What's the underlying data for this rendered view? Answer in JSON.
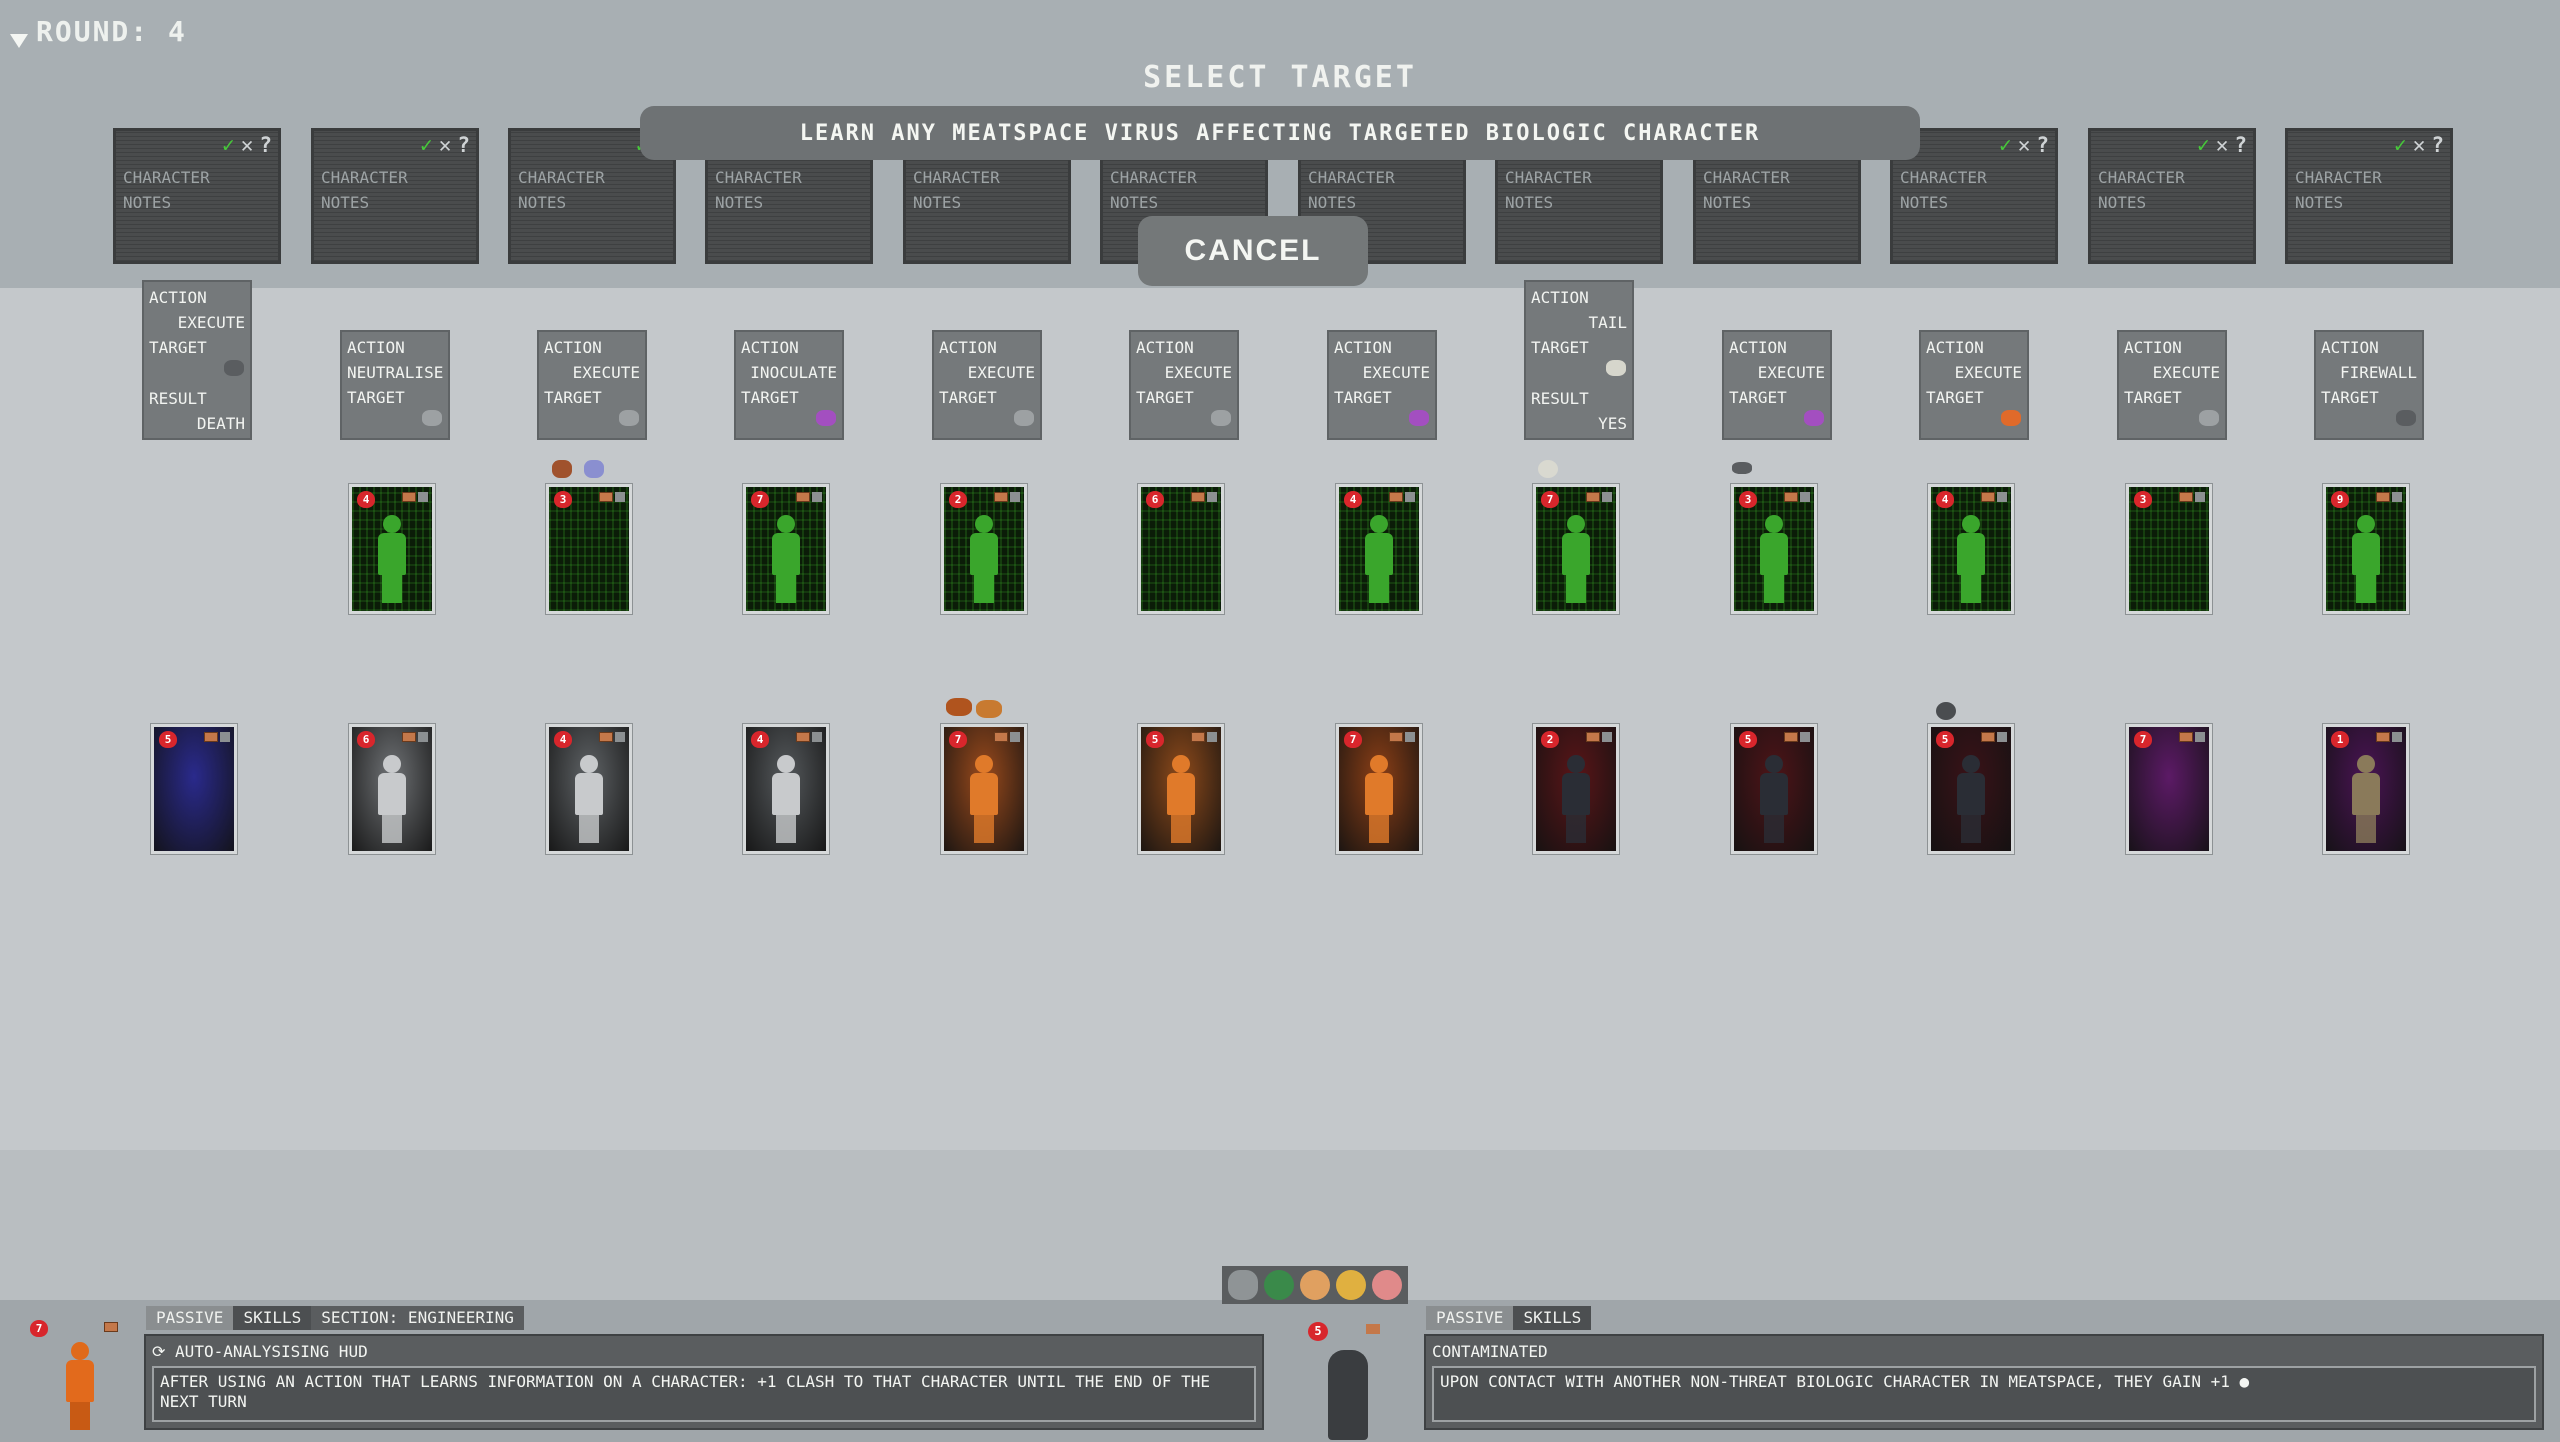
{
  "round": {
    "label": "ROUND: 4"
  },
  "title": "SELECT TARGET",
  "banner": "LEARN ANY MEATSPACE VIRUS AFFECTING TARGETED BIOLOGIC CHARACTER",
  "cancel_label": "CANCEL",
  "notes_label": "CHARACTER\nNOTES",
  "notes": [
    {
      "flags": [
        "ck",
        "xx",
        "qq"
      ]
    },
    {
      "flags": [
        "ck",
        "xx",
        "qq"
      ]
    },
    {
      "flags": [
        "ck",
        "xx"
      ]
    },
    {
      "flags": []
    },
    {
      "flags": []
    },
    {
      "flags": []
    },
    {
      "flags": []
    },
    {
      "flags": []
    },
    {
      "flags": []
    },
    {
      "flags": [
        "ck",
        "xx",
        "qq"
      ]
    },
    {
      "flags": [
        "ck",
        "xx",
        "qq"
      ]
    },
    {
      "flags": [
        "ck",
        "xx",
        "qq"
      ]
    }
  ],
  "actions": [
    {
      "l1": "ACTION",
      "l2": "EXECUTE",
      "l3": "TARGET",
      "res": "RESULT",
      "resv": "DEATH",
      "icon": "gun-icon"
    },
    {
      "l1": "ACTION",
      "l2": "NEUTRALISE",
      "l3": "TARGET",
      "icon": "pin-icon"
    },
    {
      "l1": "ACTION",
      "l2": "EXECUTE",
      "l3": "TARGET",
      "icon": "pin-icon"
    },
    {
      "l1": "ACTION",
      "l2": "INOCULATE",
      "l3": "TARGET",
      "icon": "virus-icon"
    },
    {
      "l1": "ACTION",
      "l2": "EXECUTE",
      "l3": "TARGET",
      "icon": "pin-icon"
    },
    {
      "l1": "ACTION",
      "l2": "EXECUTE",
      "l3": "TARGET",
      "icon": "pin-icon"
    },
    {
      "l1": "ACTION",
      "l2": "EXECUTE",
      "l3": "TARGET",
      "icon": "virus-icon"
    },
    {
      "l1": "ACTION",
      "l2": "TAIL",
      "l3": "TARGET",
      "res": "RESULT",
      "resv": "YES",
      "icon": "face-icon"
    },
    {
      "l1": "ACTION",
      "l2": "EXECUTE",
      "l3": "TARGET",
      "icon": "virus-icon"
    },
    {
      "l1": "ACTION",
      "l2": "EXECUTE",
      "l3": "TARGET",
      "icon": "mushroom-icon"
    },
    {
      "l1": "ACTION",
      "l2": "EXECUTE",
      "l3": "TARGET",
      "icon": "pin-icon"
    },
    {
      "l1": "ACTION",
      "l2": "FIREWALL",
      "l3": "TARGET",
      "icon": "gun-icon"
    }
  ],
  "green_cards": [
    {
      "hp": "4"
    },
    {
      "hp": "3"
    },
    {
      "hp": "7"
    },
    {
      "hp": "2"
    },
    {
      "hp": "6"
    },
    {
      "hp": "4"
    },
    {
      "hp": "7"
    },
    {
      "hp": "3"
    },
    {
      "hp": "4"
    },
    {
      "hp": "3"
    },
    {
      "hp": "9"
    }
  ],
  "color_cards": [
    {
      "hp": "5",
      "bg": "#2a2a8c"
    },
    {
      "hp": "6",
      "bg": "#6f7275"
    },
    {
      "hp": "4",
      "bg": "#5f6366"
    },
    {
      "hp": "4",
      "bg": "#55595c"
    },
    {
      "hp": "7",
      "bg": "#9a4a1c"
    },
    {
      "hp": "5",
      "bg": "#8e4a1a"
    },
    {
      "hp": "7",
      "bg": "#8c3f16"
    },
    {
      "hp": "2",
      "bg": "#5a1518"
    },
    {
      "hp": "5",
      "bg": "#4e1418"
    },
    {
      "hp": "5",
      "bg": "#3a1218"
    },
    {
      "hp": "7",
      "bg": "#5c1a66"
    },
    {
      "hp": "1",
      "bg": "#4a1454"
    }
  ],
  "left_panel": {
    "tab1": "PASSIVE",
    "tab2": "SKILLS",
    "section": "SECTION: ENGINEERING",
    "skill_name": "AUTO-ANALYSISING HUD",
    "skill_desc": "AFTER USING AN ACTION THAT LEARNS INFORMATION ON A CHARACTER: +1 CLASH TO THAT CHARACTER UNTIL THE END OF THE NEXT TURN",
    "hp": "7"
  },
  "right_panel": {
    "tab1": "PASSIVE",
    "tab2": "SKILLS",
    "skill_name": "CONTAMINATED",
    "skill_desc": "UPON CONTACT WITH ANOTHER NON-THREAT BIOLOGIC CHARACTER IN MEATSPACE, THEY GAIN +1",
    "hp": "5"
  },
  "footer_icons": [
    "pin-icon",
    "earth-icon",
    "person-icon",
    "boot-icon",
    "brain-icon"
  ],
  "colors": {
    "green": "#3aa62c",
    "heart": "#d8262c",
    "check": "#46c83a"
  }
}
